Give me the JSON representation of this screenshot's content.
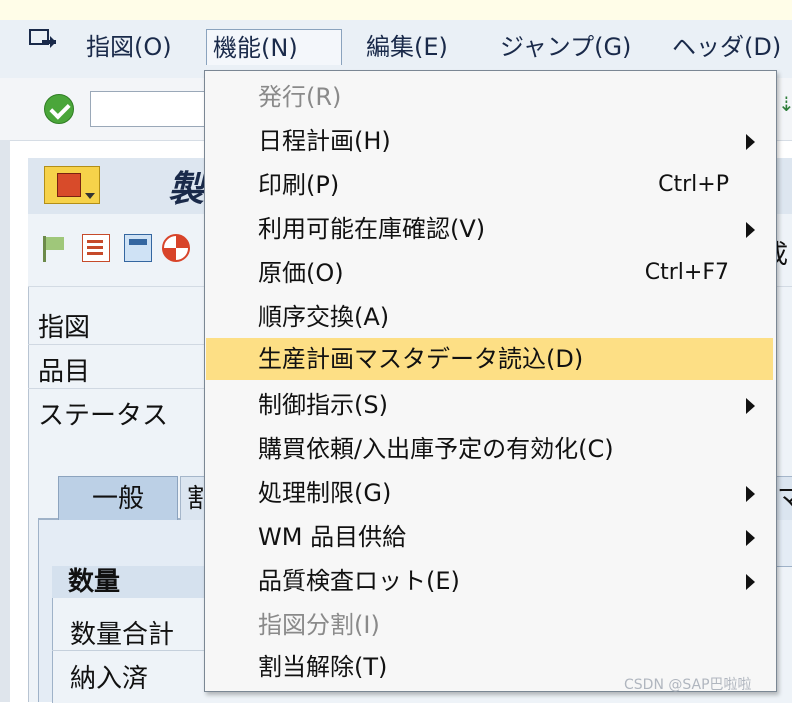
{
  "menubar": {
    "items": [
      {
        "label": "指図(O)"
      },
      {
        "label": "機能(N)"
      },
      {
        "label": "編集(E)"
      },
      {
        "label": "ジャンプ(G)"
      },
      {
        "label": "ヘッダ(D)"
      }
    ]
  },
  "toolbar": {
    "command_value": ""
  },
  "screen": {
    "title_partial": "製",
    "fields": [
      {
        "label": "指図"
      },
      {
        "label": "品目"
      },
      {
        "label": "ステータス"
      }
    ],
    "tabs": [
      {
        "label": "一般"
      },
      {
        "label": "割"
      },
      {
        "label": "マ"
      }
    ],
    "group": {
      "title": "数量",
      "fields": [
        {
          "label": "数量合計"
        },
        {
          "label": "納入済"
        }
      ]
    },
    "right_partial_char": "成"
  },
  "dropdown": {
    "items": [
      {
        "label": "発行(R)",
        "shortcut": "",
        "submenu": false,
        "disabled": true
      },
      {
        "label": "日程計画(H)",
        "shortcut": "",
        "submenu": true,
        "disabled": false
      },
      {
        "label": "印刷(P)",
        "shortcut": "Ctrl+P",
        "submenu": false,
        "disabled": false
      },
      {
        "label": "利用可能在庫確認(V)",
        "shortcut": "",
        "submenu": true,
        "disabled": false
      },
      {
        "label": "原価(O)",
        "shortcut": "Ctrl+F7",
        "submenu": false,
        "disabled": false
      },
      {
        "label": "順序交換(A)",
        "shortcut": "",
        "submenu": false,
        "disabled": false
      },
      {
        "label": "生産計画マスタデータ読込(D)",
        "shortcut": "",
        "submenu": false,
        "disabled": false,
        "highlighted": true
      },
      {
        "label": "制御指示(S)",
        "shortcut": "",
        "submenu": true,
        "disabled": false
      },
      {
        "label": "購買依頼/入出庫予定の有効化(C)",
        "shortcut": "",
        "submenu": false,
        "disabled": false
      },
      {
        "label": "処理制限(G)",
        "shortcut": "",
        "submenu": true,
        "disabled": false
      },
      {
        "label": "WM 品目供給",
        "shortcut": "",
        "submenu": true,
        "disabled": false
      },
      {
        "label": "品質検査ロット(E)",
        "shortcut": "",
        "submenu": true,
        "disabled": false
      },
      {
        "label": "指図分割(I)",
        "shortcut": "",
        "submenu": false,
        "disabled": true
      },
      {
        "label": "割当解除(T)",
        "shortcut": "",
        "submenu": false,
        "disabled": false
      }
    ]
  },
  "watermark": "CSDN @SAP巴啦啦",
  "colors": {
    "highlight": "#fddf85",
    "disabled_text": "#8a8a8a",
    "menubar_bg": "#eaf0f6"
  }
}
